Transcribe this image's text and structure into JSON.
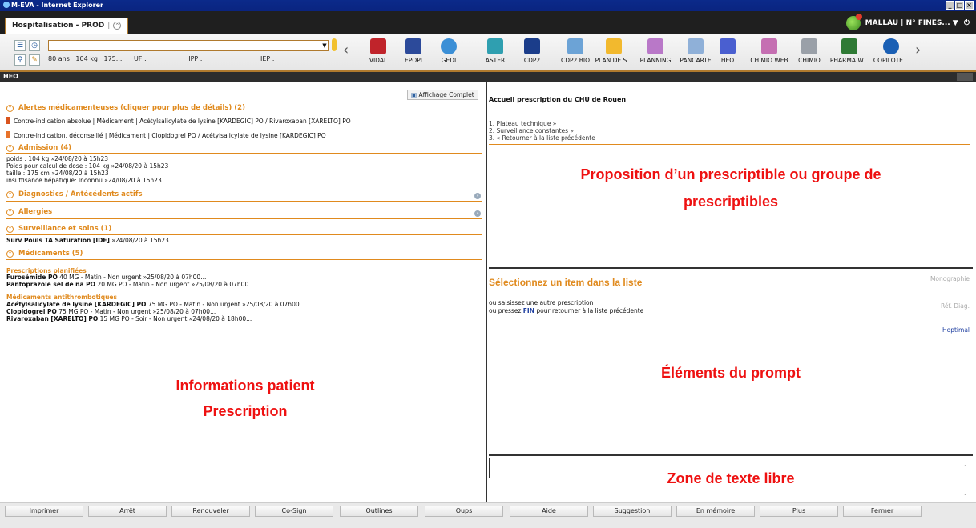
{
  "window": {
    "title": "M-EVA - Internet Explorer",
    "controls": [
      "_",
      "□",
      "×"
    ]
  },
  "tab": {
    "label": "Hospitalisation - PROD"
  },
  "user": {
    "label": "MALLAU | N° FINES... ▼"
  },
  "toolbar": {
    "search_value": "",
    "info": {
      "age": "80 ans",
      "weight": "104 kg",
      "height": "175...",
      "uf": "UF :",
      "ipp": "IPP :",
      "iep": "IEP :"
    },
    "apps": [
      {
        "label": "VIDAL",
        "icon": "vidal-icon",
        "color": "#c0242b"
      },
      {
        "label": "EPOPI",
        "icon": "epopi-icon",
        "color": "#2c4a9a"
      },
      {
        "label": "GEDI",
        "icon": "gedi-icon",
        "color": "#3b8fd6"
      },
      {
        "label": "ASTER",
        "icon": "aster-icon",
        "color": "#2f9fb0"
      },
      {
        "label": "CDP2",
        "icon": "cdp2-icon",
        "color": "#1b3d8a"
      },
      {
        "label": "CDP2 BIO",
        "icon": "cdp2-bio-icon",
        "color": "#6ca3d6"
      },
      {
        "label": "PLAN DE S...",
        "icon": "plan-de-soins-icon",
        "color": "#f2b92e"
      },
      {
        "label": "PLANNING",
        "icon": "planning-icon",
        "color": "#b978c8"
      },
      {
        "label": "PANCARTE",
        "icon": "pancarte-icon",
        "color": "#8fb0d8"
      },
      {
        "label": "HEO",
        "icon": "heo-icon",
        "color": "#4a5fd0"
      },
      {
        "label": "CHIMIO WEB",
        "icon": "chimio-web-icon",
        "color": "#c56fb2"
      },
      {
        "label": "CHIMIO",
        "icon": "chimio-icon",
        "color": "#9aa0a8"
      },
      {
        "label": "PHARMA W...",
        "icon": "pharma-web-icon",
        "color": "#2f7a35"
      },
      {
        "label": "COPILOTE...",
        "icon": "copilote-icon",
        "color": "#1a5fb4"
      }
    ]
  },
  "heo_bar": {
    "title": "HEO"
  },
  "left": {
    "affichage_label": "Affichage Complet",
    "alerts": {
      "title": "Alertes médicamenteuses (cliquer pour plus de détails) (2)",
      "items": [
        "Contre-indication absolue | Médicament | Acétylsalicylate de lysine [KARDEGIC] PO / Rivaroxaban [XARELTO] PO",
        "Contre-indication, déconseillé | Médicament | Clopidogrel PO / Acétylsalicylate de lysine [KARDEGIC] PO"
      ]
    },
    "admission": {
      "title": "Admission (4)",
      "items": [
        "poids : 104 kg »24/08/20 à 15h23",
        "Poids pour calcul de dose : 104 kg »24/08/20 à 15h23",
        "taille : 175 cm »24/08/20 à 15h23",
        "insuffisance hépatique: Inconnu »24/08/20 à 15h23"
      ]
    },
    "diagnostics": {
      "title": "Diagnostics / Antécédents actifs"
    },
    "allergies": {
      "title": "Allergies"
    },
    "surveillance": {
      "title": "Surveillance et soins (1)",
      "items": [
        {
          "bold": "Surv Pouls TA Saturation [IDE]",
          "rest": " »24/08/20 à 15h23..."
        }
      ]
    },
    "medicaments": {
      "title": "Médicaments (5)",
      "group1_title": "Prescriptions planifiées",
      "group1": [
        {
          "bold": "Furosémide PO",
          "rest": " 40 MG - Matin - Non urgent »25/08/20 à 07h00..."
        },
        {
          "bold": "Pantoprazole sel de na PO",
          "rest": " 20 MG PO - Matin - Non urgent »25/08/20 à 07h00..."
        }
      ],
      "group2_title": "Médicaments antithrombotiques",
      "group2": [
        {
          "bold": "Acétylsalicylate de lysine [KARDEGIC] PO",
          "rest": " 75 MG PO - Matin - Non urgent »25/08/20 à 07h00..."
        },
        {
          "bold": "Clopidogrel PO",
          "rest": " 75 MG PO - Matin - Non urgent »25/08/20 à 07h00..."
        },
        {
          "bold": "Rivaroxaban [XARELTO] PO",
          "rest": " 15 MG PO - Soir - Non urgent »24/08/20 à 18h00..."
        }
      ]
    },
    "annotation_line1": "Informations patient",
    "annotation_line2": "Prescription"
  },
  "right_top": {
    "title": "Accueil prescription du CHU de Rouen",
    "items": [
      "1. Plateau technique »",
      "2. Surveillance constantes »",
      "3. « Retourner à la liste précédente"
    ],
    "annotation_line1": "Proposition d’un prescriptible ou groupe de",
    "annotation_line2": "prescriptibles"
  },
  "right_mid": {
    "title": "Sélectionnez un item dans la liste",
    "line1": "ou saisissez une autre prescription",
    "line2_pre": "ou pressez ",
    "line2_key": "FIN",
    "line2_post": " pour retourner à la liste précédente",
    "link_monographie": "Monographie",
    "link_ref_diag": "Réf. Diag.",
    "link_hoptimal": "Hoptimal",
    "annotation": "Éléments du prompt"
  },
  "right_bot": {
    "annotation": "Zone de texte libre"
  },
  "buttons": [
    "Imprimer",
    "Arrêt",
    "Renouveler",
    "Co-Sign",
    "Outlines",
    "Oups",
    "Aide",
    "Suggestion",
    "En mémoire",
    "Plus",
    "Fermer"
  ]
}
